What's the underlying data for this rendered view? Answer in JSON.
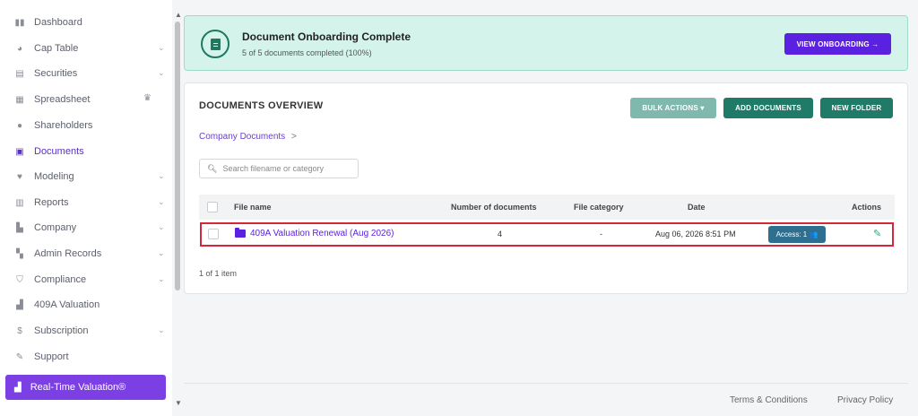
{
  "sidebar": {
    "items": [
      {
        "label": "Dashboard",
        "icon": "dashboard-icon",
        "chevron": false
      },
      {
        "label": "Cap Table",
        "icon": "pie-chart-icon",
        "chevron": true
      },
      {
        "label": "Securities",
        "icon": "clipboard-icon",
        "chevron": true
      },
      {
        "label": "Spreadsheet",
        "icon": "spreadsheet-icon",
        "chevron": false,
        "crown": true
      },
      {
        "label": "Shareholders",
        "icon": "person-icon",
        "chevron": false
      },
      {
        "label": "Documents",
        "icon": "folder-icon",
        "chevron": false,
        "active": true
      },
      {
        "label": "Modeling",
        "icon": "lightbulb-icon",
        "chevron": true
      },
      {
        "label": "Reports",
        "icon": "report-icon",
        "chevron": true
      },
      {
        "label": "Company",
        "icon": "building-icon",
        "chevron": true
      },
      {
        "label": "Admin Records",
        "icon": "records-icon",
        "chevron": true
      },
      {
        "label": "Compliance",
        "icon": "shield-icon",
        "chevron": true
      },
      {
        "label": "409A Valuation",
        "icon": "chart-icon",
        "chevron": false
      },
      {
        "label": "Subscription",
        "icon": "dollar-icon",
        "chevron": true
      },
      {
        "label": "Support",
        "icon": "support-icon",
        "chevron": false
      }
    ],
    "highlight_item": {
      "label": "Real-Time Valuation®",
      "icon": "chart-icon"
    }
  },
  "banner": {
    "title": "Document Onboarding Complete",
    "subtitle": "5 of 5 documents completed (100%)",
    "button_label": "VIEW ONBOARDING →"
  },
  "documents": {
    "title": "DOCUMENTS OVERVIEW",
    "buttons": {
      "bulk": "BULK ACTIONS ▾",
      "add": "ADD DOCUMENTS",
      "folder": "NEW FOLDER"
    },
    "breadcrumb": "Company Documents",
    "breadcrumb_sep": ">",
    "search_placeholder": "Search filename or category",
    "columns": {
      "name": "File name",
      "count": "Number of documents",
      "category": "File category",
      "date": "Date",
      "actions": "Actions"
    },
    "rows": [
      {
        "name": "409A Valuation Renewal (Aug 2026)",
        "count": "4",
        "category": "-",
        "date": "Aug 06, 2026 8:51 PM",
        "access": "Access: 1 👥"
      }
    ],
    "pager": "1 of 1 item"
  },
  "footer": {
    "terms": "Terms & Conditions",
    "privacy": "Privacy Policy"
  },
  "colors": {
    "accent": "#5b21e0",
    "active_nav": "#5c2fc2",
    "teal_button": "#1f7b67",
    "banner_bg": "#d4f3eb",
    "highlight_row_border": "#d4283a"
  }
}
